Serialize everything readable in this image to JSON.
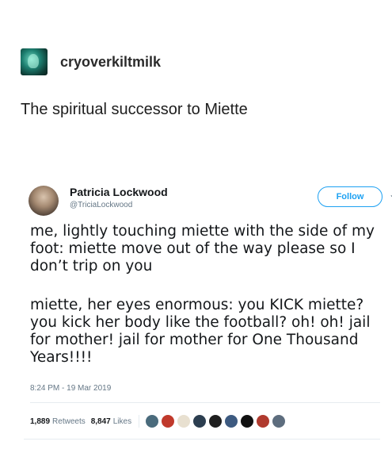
{
  "post": {
    "blog_name": "cryoverkiltmilk",
    "title": "The spiritual successor to Miette"
  },
  "tweet": {
    "author_name": "Patricia Lockwood",
    "handle": "@TriciaLockwood",
    "follow_label": "Follow",
    "caret_icon": "chevron-down-icon",
    "paragraph1": "me, lightly touching miette with the side of my foot: miette move out of the way please so I don’t trip on you",
    "paragraph2": "miette, her eyes enormous: you KICK miette? you kick her body like the football? oh! oh! jail for mother! jail for mother for One Thousand Years!!!!",
    "timestamp": "8:24 PM - 19 Mar 2019",
    "retweets_count": "1,889",
    "retweets_label": "Retweets",
    "likes_count": "8,847",
    "likes_label": "Likes",
    "liker_colors": [
      "#4a6b7c",
      "#c0392b",
      "#e8e0d0",
      "#2c3e50",
      "#1f1f1f",
      "#3d5a80",
      "#111111",
      "#b03a2e",
      "#5d6d7e"
    ]
  },
  "colors": {
    "twitter_blue": "#1da1f2",
    "secondary_text": "#657786"
  }
}
